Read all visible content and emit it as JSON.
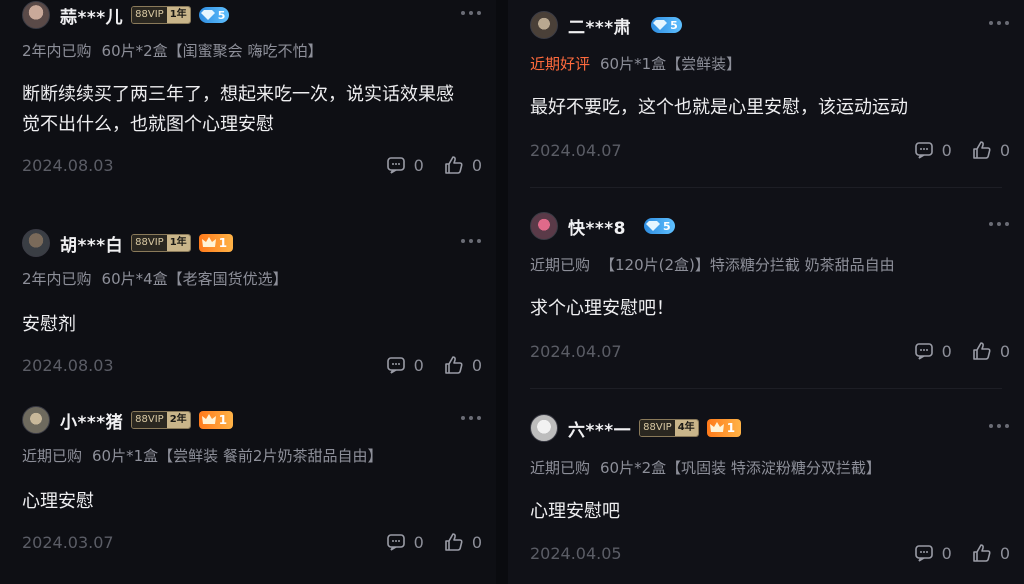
{
  "left": [
    {
      "user": "蒜***儿",
      "vip": "88VIP",
      "vip_years": "1年",
      "badge": "diamond",
      "badge_level": "5",
      "purchase_tag": "2年内已购",
      "spec": "60片*2盒【闺蜜聚会 嗨吃不怕】",
      "content": "断断续续买了两三年了，想起来吃一次，说实话效果感觉不出什么，也就图个心理安慰",
      "date": "2024.08.03",
      "comments": "0",
      "likes": "0"
    },
    {
      "user": "胡***白",
      "vip": "88VIP",
      "vip_years": "1年",
      "badge": "crown",
      "badge_level": "1",
      "purchase_tag": "2年内已购",
      "spec": "60片*4盒【老客国货优选】",
      "content": "安慰剂",
      "date": "2024.08.03",
      "comments": "0",
      "likes": "0"
    },
    {
      "user": "小***猪",
      "vip": "88VIP",
      "vip_years": "2年",
      "badge": "crown",
      "badge_level": "1",
      "purchase_tag": "近期已购",
      "spec": "60片*1盒【尝鲜装 餐前2片奶茶甜品自由】",
      "content": "心理安慰",
      "date": "2024.03.07",
      "comments": "0",
      "likes": "0"
    }
  ],
  "right": [
    {
      "user": "二***肃",
      "vip": "",
      "vip_years": "",
      "badge": "diamond",
      "badge_level": "5",
      "purchase_tag": "近期好评",
      "purchase_tag_hot": true,
      "spec": "60片*1盒【尝鲜装】",
      "content": "最好不要吃，这个也就是心里安慰，该运动运动",
      "date": "2024.04.07",
      "comments": "0",
      "likes": "0"
    },
    {
      "user": "快***8",
      "vip": "",
      "vip_years": "",
      "badge": "diamond",
      "badge_level": "5",
      "purchase_tag": "近期已购",
      "spec": "【120片(2盒)】特添糖分拦截 奶茶甜品自由",
      "content": "求个心理安慰吧！",
      "date": "2024.04.07",
      "comments": "0",
      "likes": "0"
    },
    {
      "user": "六***一",
      "vip": "88VIP",
      "vip_years": "4年",
      "badge": "crown",
      "badge_level": "1",
      "purchase_tag": "近期已购",
      "spec": "60片*2盒【巩固装 特添淀粉糖分双拦截】",
      "content": "心理安慰吧",
      "date": "2024.04.05",
      "comments": "0",
      "likes": "0"
    }
  ],
  "colors": {
    "background": "#0e0f14",
    "accent_hot": "#ff6a3d",
    "diamond": "#3aa0f0",
    "crown": "#ff8c2a"
  },
  "icons": {
    "comment": "comment-icon",
    "like": "thumbs-up-icon",
    "more": "more-dots-icon"
  }
}
